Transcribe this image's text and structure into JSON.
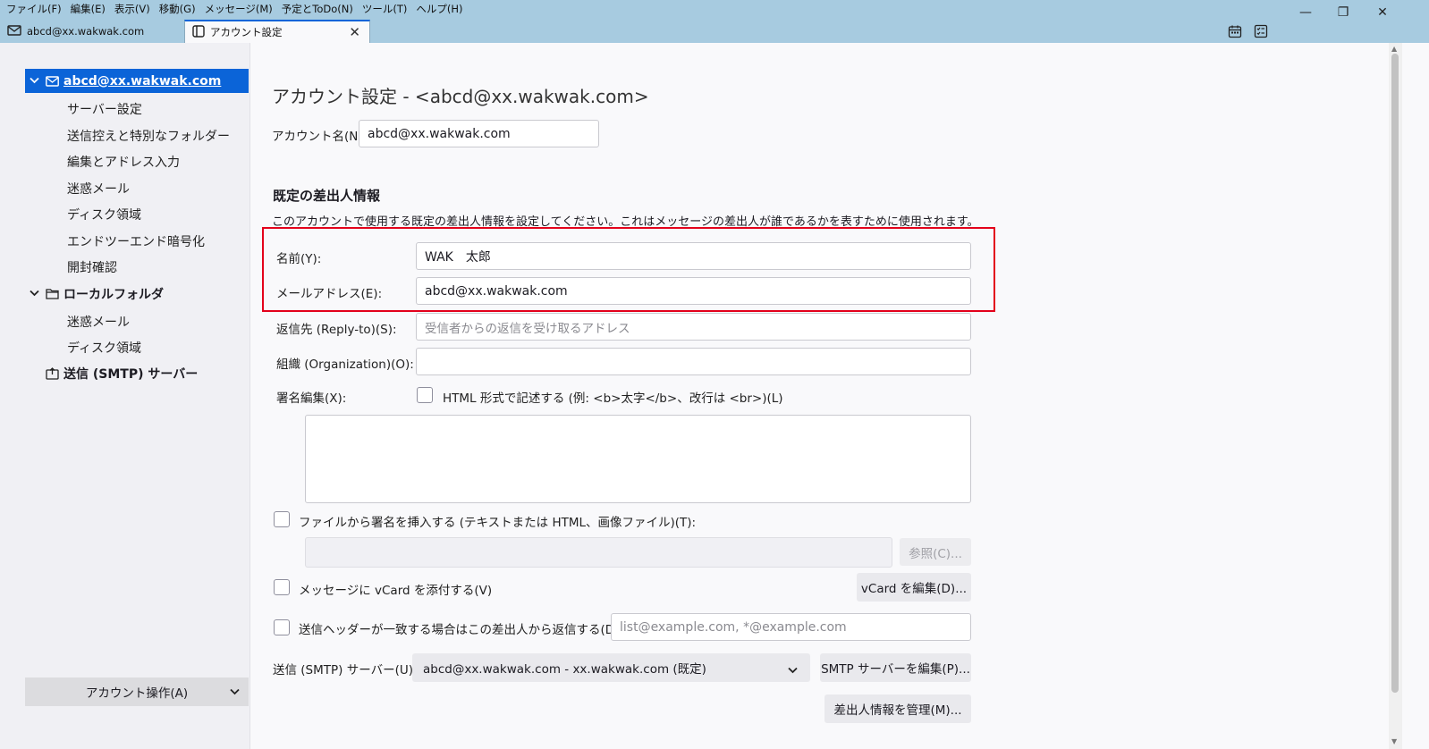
{
  "menubar": {
    "items": [
      "ファイル(F)",
      "編集(E)",
      "表示(V)",
      "移動(G)",
      "メッセージ(M)",
      "予定とToDo(N)",
      "ツール(T)",
      "ヘルプ(H)"
    ]
  },
  "window_controls": {
    "minimize": "—",
    "restore": "❐",
    "close": "✕"
  },
  "tabs": {
    "mail": "abcd@xx.wakwak.com",
    "account_settings": "アカウント設定",
    "close": "✕"
  },
  "sidebar": {
    "account": "abcd@xx.wakwak.com",
    "account_items": [
      "サーバー設定",
      "送信控えと特別なフォルダー",
      "編集とアドレス入力",
      "迷惑メール",
      "ディスク領域",
      "エンドツーエンド暗号化",
      "開封確認"
    ],
    "local_folders": "ローカルフォルダ",
    "local_items": [
      "迷惑メール",
      "ディスク領域"
    ],
    "smtp": "送信 (SMTP) サーバー",
    "account_actions": "アカウント操作(A)"
  },
  "main": {
    "title": "アカウント設定 - <abcd@xx.wakwak.com>",
    "account_name_label": "アカウント名(N):",
    "account_name_value": "abcd@xx.wakwak.com",
    "identity_heading": "既定の差出人情報",
    "identity_desc": "このアカウントで使用する既定の差出人情報を設定してください。これはメッセージの差出人が誰であるかを表すために使用されます。",
    "name_label": "名前(Y):",
    "name_value": "WAK　太郎",
    "email_label": "メールアドレス(E):",
    "email_value": "abcd@xx.wakwak.com",
    "replyto_label": "返信先 (Reply-to)(S):",
    "replyto_placeholder": "受信者からの返信を受け取るアドレス",
    "org_label": "組織 (Organization)(O):",
    "org_value": "",
    "signature_label": "署名編集(X):",
    "html_checkbox_label": "HTML 形式で記述する (例: <b>太字</b>、改行は <br>)(L)",
    "signature_file_label": "ファイルから署名を挿入する (テキストまたは HTML、画像ファイル)(T):",
    "browse_button": "参照(C)...",
    "vcard_label": "メッセージに vCard を添付する(V)",
    "vcard_button": "vCard を編集(D)...",
    "reply_header_label": "送信ヘッダーが一致する場合はこの差出人から返信する(D):",
    "reply_header_placeholder": "list@example.com, *@example.com",
    "smtp_label": "送信 (SMTP) サーバー(U):",
    "smtp_value": "abcd@xx.wakwak.com - xx.wakwak.com (既定)",
    "smtp_edit_button": "SMTP サーバーを編集(P)...",
    "manage_identities_button": "差出人情報を管理(M)..."
  }
}
